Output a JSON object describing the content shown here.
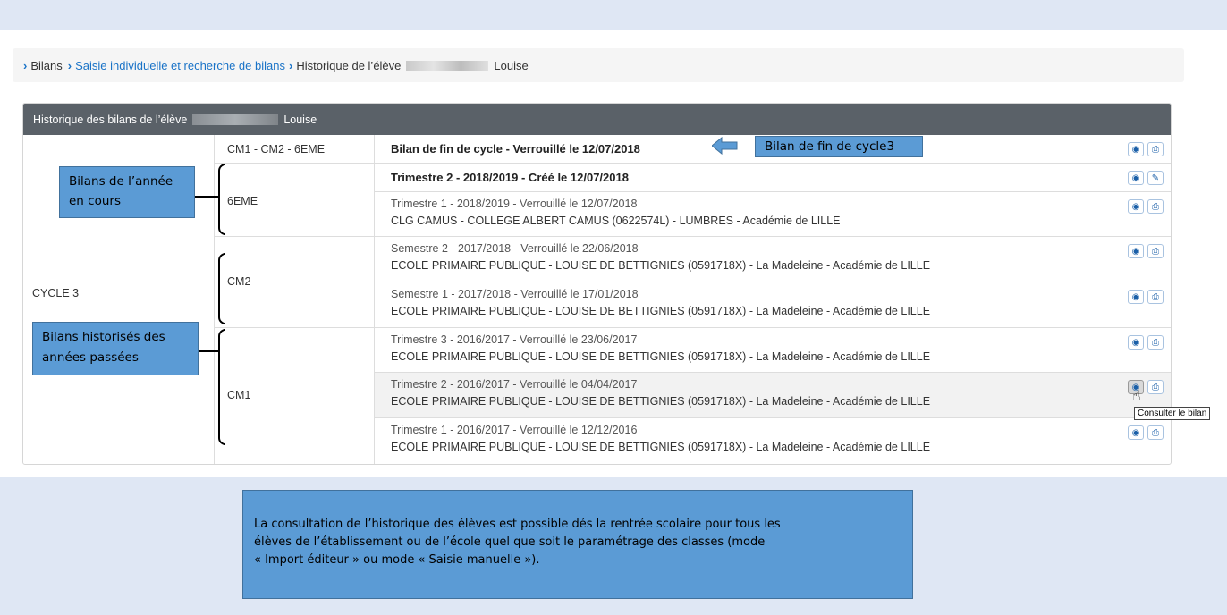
{
  "breadcrumb": {
    "item1": "Bilans",
    "item2": "Saisie individuelle et recherche de bilans",
    "current_prefix": "Historique de l’élève",
    "current_suffix": "Louise"
  },
  "panel": {
    "title_prefix": "Historique des bilans de l’élève",
    "title_suffix": "Louise"
  },
  "cycle": "CYCLE 3",
  "levels": {
    "end": "CM1 - CM2 - 6EME",
    "l6": "6EME",
    "cm2": "CM2",
    "cm1": "CM1"
  },
  "rows": [
    {
      "line1": "Bilan de fin de cycle - Verrouillé le 12/07/2018",
      "line2": ""
    },
    {
      "line1": "Trimestre 2 - 2018/2019 - Créé le 12/07/2018",
      "line2": ""
    },
    {
      "line1": "Trimestre 1 - 2018/2019 - Verrouillé le 12/07/2018",
      "line2": "CLG CAMUS - COLLEGE ALBERT CAMUS (0622574L) - LUMBRES - Académie de LILLE"
    },
    {
      "line1": "Semestre 2 - 2017/2018 - Verrouillé le 22/06/2018",
      "line2": "ECOLE PRIMAIRE PUBLIQUE - LOUISE DE BETTIGNIES (0591718X) - La Madeleine - Académie de LILLE"
    },
    {
      "line1": "Semestre 1 - 2017/2018 - Verrouillé le 17/01/2018",
      "line2": "ECOLE PRIMAIRE PUBLIQUE - LOUISE DE BETTIGNIES (0591718X) - La Madeleine - Académie de LILLE"
    },
    {
      "line1": "Trimestre 3 - 2016/2017 - Verrouillé le 23/06/2017",
      "line2": "ECOLE PRIMAIRE PUBLIQUE - LOUISE DE BETTIGNIES (0591718X) - La Madeleine - Académie de LILLE"
    },
    {
      "line1": "Trimestre 2 - 2016/2017 - Verrouillé le 04/04/2017",
      "line2": "ECOLE PRIMAIRE PUBLIQUE - LOUISE DE BETTIGNIES (0591718X) - La Madeleine - Académie de LILLE"
    },
    {
      "line1": "Trimestre 1 - 2016/2017 - Verrouillé le 12/12/2016",
      "line2": "ECOLE PRIMAIRE PUBLIQUE - LOUISE DE BETTIGNIES (0591718X) - La Madeleine - Académie de LILLE"
    }
  ],
  "icons": {
    "view": "eye-icon",
    "print": "print-icon",
    "edit": "edit-icon"
  },
  "tooltip": "Consulter le bilan",
  "callouts": {
    "end_cycle": "Bilan de fin de cycle3",
    "current_year_line1": "Bilans de l’année",
    "current_year_line2": "en cours",
    "past_years_line1": "Bilans historisés des",
    "past_years_line2": "années passées"
  },
  "note": {
    "line1": "La consultation de l’historique des élèves  est possible dés la rentrée scolaire pour tous les",
    "line2": "élèves de l’établissement ou de l’école quel que soit le paramétrage des classes  (mode",
    "line3": "« Import éditeur »  ou mode « Saisie manuelle »)."
  },
  "colors": {
    "header_bg": "#5a6168",
    "link": "#1a73c7",
    "callout": "#5b9bd5",
    "band": "#dfe7f4"
  }
}
